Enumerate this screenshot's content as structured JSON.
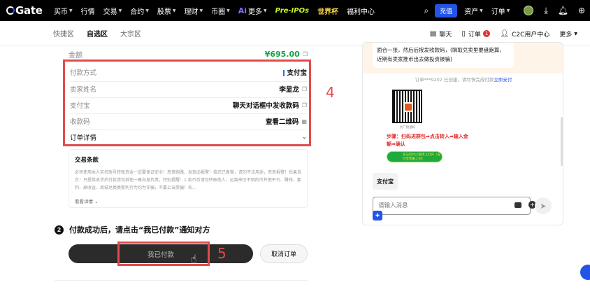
{
  "topnav": {
    "logo": "Gate",
    "items": [
      {
        "label": "买币",
        "caret": true
      },
      {
        "label": "行情",
        "caret": false
      },
      {
        "label": "交易",
        "caret": true
      },
      {
        "label": "合约",
        "caret": true
      },
      {
        "label": "股票",
        "caret": true
      },
      {
        "label": "理财",
        "caret": true
      },
      {
        "label": "币圈",
        "caret": true
      }
    ],
    "ai_label": "更多",
    "preipo": "Pre-IPOs",
    "worldcup": "世界杯",
    "welfare": "福利中心",
    "deposit": "充值",
    "assets": "资产",
    "orders": "订单"
  },
  "subnav": {
    "tabs": [
      "快捷区",
      "自选区",
      "大宗区"
    ],
    "active_index": 1,
    "chat": "聊天",
    "order": "订单",
    "order_badge": "1",
    "c2c": "C2C用户中心",
    "more": "更多"
  },
  "order": {
    "amount_label": "金额",
    "amount_value": "¥695.00",
    "rows": [
      {
        "label": "付款方式",
        "value": "支付宝"
      },
      {
        "label": "卖家姓名",
        "value": "李显龙"
      },
      {
        "label": "支付宝",
        "value": "聊天对话框中发收款码"
      },
      {
        "label": "收款码",
        "value": "查看二维码"
      }
    ],
    "detail_label": "订单详情"
  },
  "annotations": {
    "box4": "4",
    "box5": "5"
  },
  "terms": {
    "title": "交易条款",
    "body": "必须使用本人实名账号转账资金一定要保证安全！恶意跑路，发现必报警！偿忍已备案，请勿不法用途，恶意报警！后果自负！只提供收货后付款请勿其他一概自身负责。特别提醒：1.卖币后请勿转账他人，远离来历不明的币并把平台、赚钱、套利、高收益、商城兑换类套利行为均为诈骗，不要上当受骗！名...",
    "more": "看看详情"
  },
  "step2": {
    "num": "2",
    "text": "付款成功后，请点击“我已付款”通知对方"
  },
  "buttons": {
    "paid": "我已付款",
    "cancel": "取消订单"
  },
  "chat": {
    "top_bubble": "面合一张，然后后按发收款码，(聊取兑卖里要盘跑算，近期有卖家推币出去做投资被骗)",
    "system_msg_prefix": "订单***9202 已创建，请尽快完成付款",
    "system_msg_link": "立即支付",
    "qr_caption": "大厂接通码",
    "steps_text": "步骤：扫码进群包➡点击转入➡输入金额➡确认",
    "pill_text": "在与信付小程序上打开（支付宝客服上扫）",
    "alipay_msg": "支付宝",
    "input_placeholder": "请输入消息",
    "send_icon": "send-icon"
  }
}
